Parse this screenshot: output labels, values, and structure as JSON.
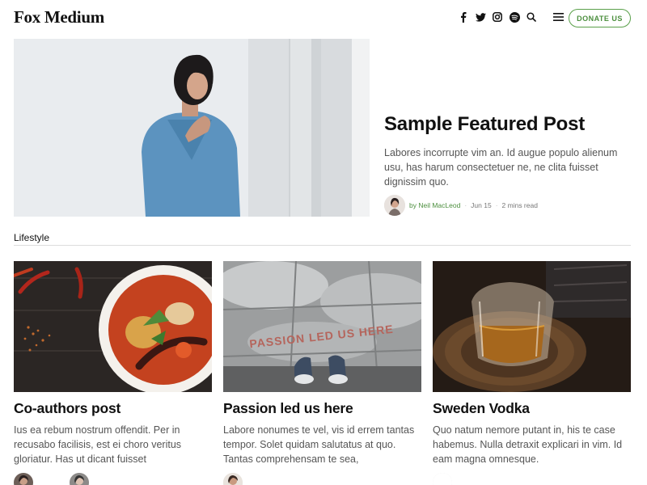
{
  "header": {
    "logo": "Fox Medium",
    "social_icons": [
      "facebook-icon",
      "twitter-icon",
      "instagram-icon",
      "spotify-icon"
    ],
    "search_icon": "search-icon",
    "menu_icon": "hamburger-menu-icon",
    "donate_label": "DONATE US"
  },
  "featured": {
    "title": "Sample Featured Post",
    "excerpt": "Labores incorrupte vim an. Id augue populo alienum usu, has harum consectetuer ne, ne clita fuisset dignissim quo.",
    "author": "by Neil MacLeod",
    "date": "Jun 15",
    "read_time": "2 mins read"
  },
  "section": {
    "label": "Lifestyle"
  },
  "cards": [
    {
      "title": "Co-authors post",
      "excerpt": "Ius ea rebum nostrum offendit. Per in recusabo facilisis, est ei choro veritus gloriatur. Has ut dicant fuisset"
    },
    {
      "title": "Passion led us here",
      "excerpt": "Labore nonumes te vel, vis id errem tantas tempor. Solet quidam salutatus at quo. Tantas comprehensam te sea,",
      "image_text": "PASSION LED US HERE"
    },
    {
      "title": "Sweden Vodka",
      "excerpt": "Quo natum nemore putant in, his te case habemus. Nulla detraxit explicari in vim. Id eam magna omnesque."
    }
  ],
  "colors": {
    "accent": "#4c8f3e",
    "text": "#111111",
    "excerpt": "#555555"
  }
}
